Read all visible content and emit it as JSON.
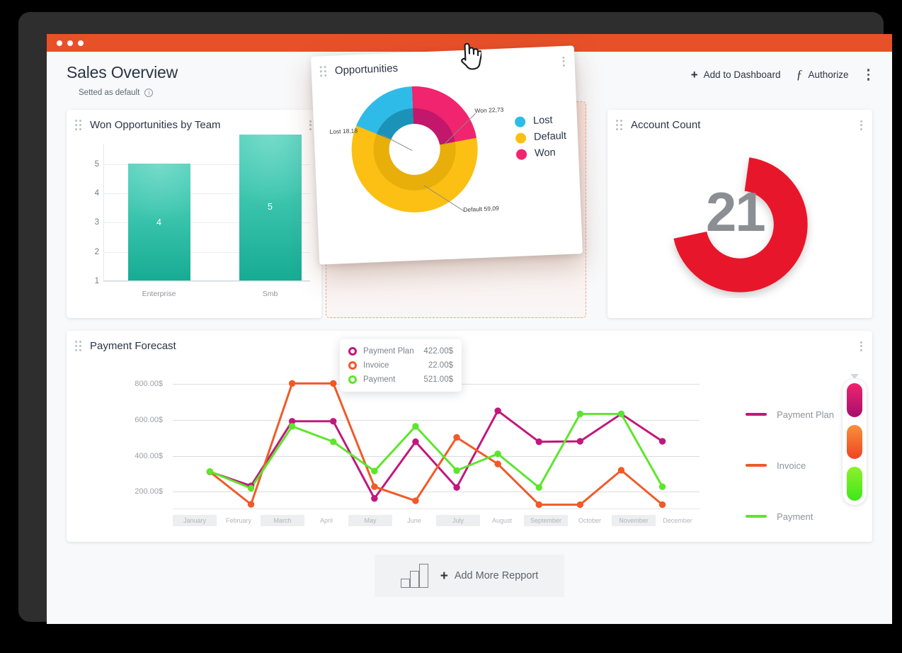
{
  "window": {
    "traffic_lights": [
      "dot-1",
      "dot-2",
      "dot-3"
    ]
  },
  "header": {
    "title": "Sales Overview",
    "subtitle": "Setted as default",
    "info_icon": "info-icon",
    "actions": [
      {
        "icon": "plus-icon",
        "label": "Add to Dashboard"
      },
      {
        "icon": "function-icon",
        "label": "Authorize"
      }
    ],
    "overflow_icon": "kebab-menu-icon"
  },
  "cards": {
    "won_opportunities": {
      "title": "Won Opportunities by Team",
      "drag_icon": "drag-handle-icon",
      "menu_icon": "kebab-menu-icon"
    },
    "opportunities": {
      "title": "Opportunities",
      "drag_icon": "drag-handle-icon",
      "menu_icon": "kebab-menu-icon",
      "cursor": "hand-pointer-cursor"
    },
    "account_count": {
      "title": "Account Count",
      "drag_icon": "drag-handle-icon",
      "menu_icon": "kebab-menu-icon",
      "value": "21"
    },
    "payment_forecast": {
      "title": "Payment Forecast",
      "drag_icon": "drag-handle-icon",
      "menu_icon": "kebab-menu-icon"
    }
  },
  "tooltip": {
    "rows": [
      {
        "name": "Payment Plan",
        "value": "422.00$",
        "color": "#c2177c"
      },
      {
        "name": "Invoice",
        "value": "22.00$",
        "color": "#f05a28"
      },
      {
        "name": "Payment",
        "value": "521.00$",
        "color": "#5ce62b"
      }
    ]
  },
  "footer": {
    "add_report_label": "Add More Repport",
    "add_plus_icon": "plus-icon",
    "chart_icon": "bar-chart-icon"
  },
  "colors": {
    "accent_orange": "#e8502a",
    "teal_bar": "#23bda6",
    "gauge_red": "#e8192c",
    "donut_lost": "#2fbbe8",
    "donut_default": "#fbc013",
    "donut_won": "#f0246f"
  },
  "chart_data": [
    {
      "type": "bar",
      "title": "Won Opportunities by Team",
      "categories": [
        "Enterprise",
        "Smb"
      ],
      "values": [
        4,
        5
      ],
      "data_labels": [
        "4",
        "5"
      ],
      "xlabel": "",
      "ylabel": "",
      "yticks": [
        1,
        2,
        3,
        4,
        5
      ],
      "ytick_labels": [
        "1",
        "2",
        "3",
        "4",
        "5"
      ],
      "ylim": [
        1,
        5.7
      ],
      "grid": true,
      "legend": "none",
      "color": "#23bda6"
    },
    {
      "type": "pie",
      "title": "Opportunities",
      "variant": "donut",
      "labels": [
        "Lost",
        "Default",
        "Won"
      ],
      "values": [
        18.18,
        59.09,
        22.73
      ],
      "annotations": [
        "Lost 18,18",
        "Default 59,09",
        "Won 22,73"
      ],
      "colors": [
        "#2fbbe8",
        "#fbc013",
        "#f0246f"
      ],
      "legend": "right",
      "legend_entries": [
        "Lost",
        "Default",
        "Won"
      ]
    },
    {
      "type": "pie",
      "title": "Account Count",
      "variant": "gauge",
      "value": 21,
      "display_value": "21",
      "color": "#e8192c",
      "track_color": "#ffffff",
      "sweep_degrees": 250
    },
    {
      "type": "line",
      "title": "Payment Forecast",
      "categories": [
        "January",
        "February",
        "March",
        "April",
        "May",
        "June",
        "July",
        "August",
        "September",
        "October",
        "November",
        "December"
      ],
      "series": [
        {
          "name": "Payment Plan",
          "color": "#c2177c",
          "values": [
            230,
            140,
            553,
            553,
            60,
            422,
            130,
            620,
            422,
            425,
            600,
            425
          ]
        },
        {
          "name": "Invoice",
          "color": "#f05a28",
          "values": [
            230,
            22,
            795,
            795,
            135,
            45,
            450,
            280,
            20,
            20,
            240,
            20
          ]
        },
        {
          "name": "Payment",
          "color": "#5ce62b",
          "values": [
            232,
            125,
            521,
            422,
            235,
            521,
            238,
            345,
            130,
            600,
            600,
            135
          ]
        }
      ],
      "ylabel": "",
      "xlabel": "",
      "yticks": [
        200,
        400,
        600,
        800
      ],
      "ytick_labels": [
        "200.00$",
        "400.00$",
        "600.00$",
        "800.00$"
      ],
      "ylim": [
        0,
        860
      ],
      "grid": true,
      "legend": "right"
    }
  ]
}
